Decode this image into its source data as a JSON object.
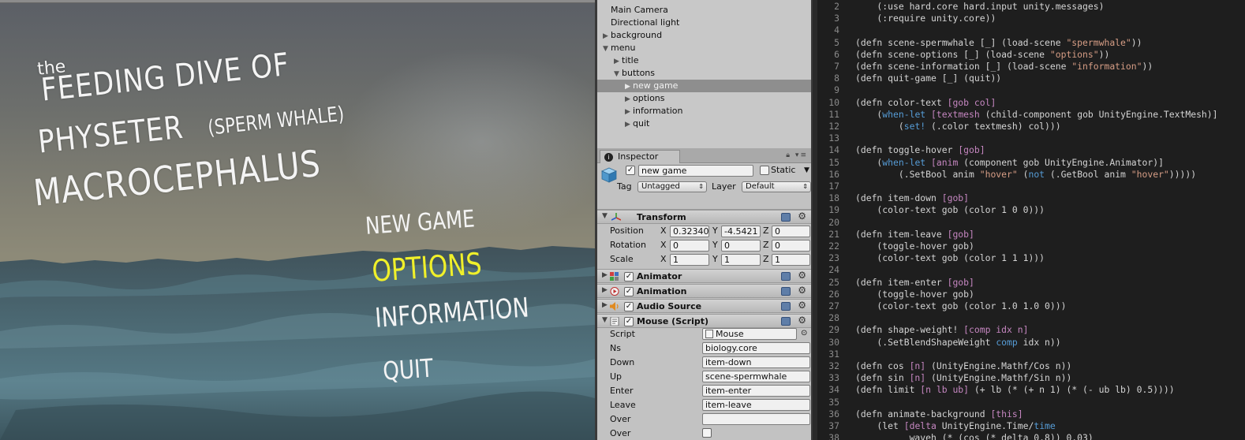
{
  "game": {
    "title_the": "the",
    "title_line1": "FEEDING DIVE OF",
    "title_line2": "PHYSETER",
    "title_line2_sub": "(SPERM WHALE)",
    "title_line3": "MACROCEPHALUS",
    "menu": {
      "new_game": "NEW GAME",
      "options": "OPTIONS",
      "information": "INFORMATION",
      "quit": "QUIT"
    },
    "highlight_color": "#f0f02a"
  },
  "hierarchy": {
    "items": [
      {
        "label": "Main Camera",
        "triangle": ""
      },
      {
        "label": "Directional light",
        "triangle": ""
      },
      {
        "label": "background",
        "triangle": "▶"
      },
      {
        "label": "menu",
        "triangle": "▼"
      },
      {
        "label": "title",
        "triangle": "▶"
      },
      {
        "label": "buttons",
        "triangle": "▼"
      },
      {
        "label": "new game",
        "triangle": "▶"
      },
      {
        "label": "options",
        "triangle": "▶"
      },
      {
        "label": "information",
        "triangle": "▶"
      },
      {
        "label": "quit",
        "triangle": "▶"
      }
    ]
  },
  "inspector": {
    "tab_label": "Inspector",
    "object_name": "new game",
    "static_label": "Static",
    "tag_label": "Tag",
    "tag_value": "Untagged",
    "layer_label": "Layer",
    "layer_value": "Default",
    "transform": {
      "title": "Transform",
      "position_label": "Position",
      "rotation_label": "Rotation",
      "scale_label": "Scale",
      "axis_x": "X",
      "axis_y": "Y",
      "axis_z": "Z",
      "position": [
        "0.32340",
        "-4.5421",
        "0"
      ],
      "rotation": [
        "0",
        "0",
        "0"
      ],
      "scale": [
        "1",
        "1",
        "1"
      ]
    },
    "components": {
      "animator": "Animator",
      "animation": "Animation",
      "audio_source": "Audio Source",
      "mouse": "Mouse (Script)"
    },
    "script": {
      "script_label": "Script",
      "script_value": "Mouse",
      "ns_label": "Ns",
      "ns_value": "biology.core",
      "down_label": "Down",
      "down_value": "item-down",
      "up_label": "Up",
      "up_value": "scene-spermwhale",
      "enter_label": "Enter",
      "enter_value": "item-enter",
      "leave_label": "Leave",
      "leave_value": "item-leave",
      "over_label": "Over",
      "over_value": "",
      "over2_label": "Over"
    }
  },
  "code": {
    "lines": [
      {
        "n": "2",
        "segs": [
          [
            "    (:use hard.core hard.input unity.messages)",
            ""
          ]
        ]
      },
      {
        "n": "3",
        "segs": [
          [
            "    (:require unity.core))",
            ""
          ]
        ]
      },
      {
        "n": "4",
        "segs": [
          [
            "",
            ""
          ]
        ]
      },
      {
        "n": "5",
        "segs": [
          [
            "(defn scene-spermwhale [_] (load-scene ",
            ""
          ],
          [
            "\"spermwhale\"",
            "s"
          ],
          [
            "))",
            ""
          ]
        ]
      },
      {
        "n": "6",
        "segs": [
          [
            "(defn scene-options [_] (load-scene ",
            ""
          ],
          [
            "\"options\"",
            "s"
          ],
          [
            "))",
            ""
          ]
        ]
      },
      {
        "n": "7",
        "segs": [
          [
            "(defn scene-information [_] (load-scene ",
            ""
          ],
          [
            "\"information\"",
            "s"
          ],
          [
            "))",
            ""
          ]
        ]
      },
      {
        "n": "8",
        "segs": [
          [
            "(defn quit-game [_] (quit))",
            ""
          ]
        ]
      },
      {
        "n": "9",
        "segs": [
          [
            "",
            ""
          ]
        ]
      },
      {
        "n": "10",
        "segs": [
          [
            "(defn color-text ",
            ""
          ],
          [
            "[gob col]",
            "b"
          ]
        ]
      },
      {
        "n": "11",
        "segs": [
          [
            "    (",
            ""
          ],
          [
            "when-let",
            "k"
          ],
          [
            " ",
            ""
          ],
          [
            "[textmesh",
            "b"
          ],
          [
            " (child-component gob UnityEngine.TextMesh)]",
            ""
          ]
        ]
      },
      {
        "n": "12",
        "segs": [
          [
            "        (",
            ""
          ],
          [
            "set!",
            "k"
          ],
          [
            " (.color textmesh) col)))",
            ""
          ]
        ]
      },
      {
        "n": "13",
        "segs": [
          [
            "",
            ""
          ]
        ]
      },
      {
        "n": "14",
        "segs": [
          [
            "(defn toggle-hover ",
            ""
          ],
          [
            "[gob]",
            "b"
          ]
        ]
      },
      {
        "n": "15",
        "segs": [
          [
            "    (",
            ""
          ],
          [
            "when-let",
            "k"
          ],
          [
            " ",
            ""
          ],
          [
            "[anim",
            "b"
          ],
          [
            " (component gob UnityEngine.Animator)]",
            ""
          ]
        ]
      },
      {
        "n": "16",
        "segs": [
          [
            "        (.SetBool anim ",
            ""
          ],
          [
            "\"hover\"",
            "s"
          ],
          [
            " (",
            ""
          ],
          [
            "not",
            "k"
          ],
          [
            " (.GetBool anim ",
            ""
          ],
          [
            "\"hover\"",
            "s"
          ],
          [
            ")))))",
            ""
          ]
        ]
      },
      {
        "n": "17",
        "segs": [
          [
            "",
            ""
          ]
        ]
      },
      {
        "n": "18",
        "segs": [
          [
            "(defn item-down ",
            ""
          ],
          [
            "[gob]",
            "b"
          ]
        ]
      },
      {
        "n": "19",
        "segs": [
          [
            "    (color-text gob (color 1 0 0)))",
            ""
          ]
        ]
      },
      {
        "n": "20",
        "segs": [
          [
            "",
            ""
          ]
        ]
      },
      {
        "n": "21",
        "segs": [
          [
            "(defn item-leave ",
            ""
          ],
          [
            "[gob]",
            "b"
          ]
        ]
      },
      {
        "n": "22",
        "segs": [
          [
            "    (toggle-hover gob)",
            ""
          ]
        ]
      },
      {
        "n": "23",
        "segs": [
          [
            "    (color-text gob (color 1 1 1)))",
            ""
          ]
        ]
      },
      {
        "n": "24",
        "segs": [
          [
            "",
            ""
          ]
        ]
      },
      {
        "n": "25",
        "segs": [
          [
            "(defn item-enter ",
            ""
          ],
          [
            "[gob]",
            "b"
          ]
        ]
      },
      {
        "n": "26",
        "segs": [
          [
            "    (toggle-hover gob)",
            ""
          ]
        ]
      },
      {
        "n": "27",
        "segs": [
          [
            "    (color-text gob (color 1.0 1.0 0)))",
            ""
          ]
        ]
      },
      {
        "n": "28",
        "segs": [
          [
            "",
            ""
          ]
        ]
      },
      {
        "n": "29",
        "segs": [
          [
            "(defn shape-weight! ",
            ""
          ],
          [
            "[comp idx n]",
            "b"
          ]
        ]
      },
      {
        "n": "30",
        "segs": [
          [
            "    (.SetBlendShapeWeight ",
            ""
          ],
          [
            "comp",
            "k"
          ],
          [
            " idx n))",
            ""
          ]
        ]
      },
      {
        "n": "31",
        "segs": [
          [
            "",
            ""
          ]
        ]
      },
      {
        "n": "32",
        "segs": [
          [
            "(defn cos ",
            ""
          ],
          [
            "[n]",
            "b"
          ],
          [
            " (UnityEngine.Mathf/Cos n))",
            ""
          ]
        ]
      },
      {
        "n": "33",
        "segs": [
          [
            "(defn sin ",
            ""
          ],
          [
            "[n]",
            "b"
          ],
          [
            " (UnityEngine.Mathf/Sin n))",
            ""
          ]
        ]
      },
      {
        "n": "34",
        "segs": [
          [
            "(defn limit ",
            ""
          ],
          [
            "[n lb ub]",
            "b"
          ],
          [
            " (+ lb (* (+ n 1) (* (- ub lb) 0.5))))",
            ""
          ]
        ]
      },
      {
        "n": "35",
        "segs": [
          [
            "",
            ""
          ]
        ]
      },
      {
        "n": "36",
        "segs": [
          [
            "(defn animate-background ",
            ""
          ],
          [
            "[this]",
            "b"
          ]
        ]
      },
      {
        "n": "37",
        "segs": [
          [
            "    (let ",
            ""
          ],
          [
            "[delta",
            "b"
          ],
          [
            " UnityEngine.Time/",
            ""
          ],
          [
            "time",
            "k"
          ]
        ]
      },
      {
        "n": "38",
        "segs": [
          [
            "          waveh (* (cos (* delta 0.8)) 0.03)",
            ""
          ]
        ]
      }
    ]
  }
}
